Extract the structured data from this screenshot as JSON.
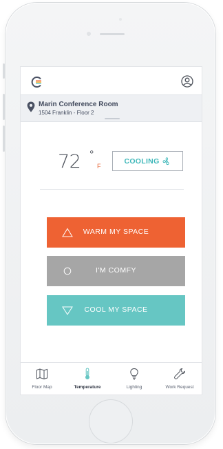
{
  "app": {
    "colors": {
      "warm": "#ee6233",
      "comfy": "#a6a6a6",
      "cool": "#66c6c3",
      "accent_teal": "#3fb8ba",
      "pin": "#4a5163"
    }
  },
  "header": {
    "logo_icon": "brand-logo-icon",
    "profile_icon": "user-circle-icon"
  },
  "location": {
    "icon": "map-pin-icon",
    "room": "Marin Conference Room",
    "address": "1504 Franklin - Floor 2"
  },
  "climate": {
    "temperature": "72",
    "degree_symbol": "°",
    "unit": "F",
    "mode_label": "COOLING",
    "mode_icon": "fan-icon"
  },
  "actions": [
    {
      "label": "WARM MY SPACE",
      "icon": "triangle-up-icon"
    },
    {
      "label": "I'M COMFY",
      "icon": "circle-icon"
    },
    {
      "label": "COOL MY SPACE",
      "icon": "triangle-down-icon"
    }
  ],
  "tabs": [
    {
      "label": "Floor Map",
      "icon": "map-icon",
      "active": false
    },
    {
      "label": "Temperature",
      "icon": "thermometer-icon",
      "active": true
    },
    {
      "label": "Lighting",
      "icon": "lightbulb-icon",
      "active": false
    },
    {
      "label": "Work Request",
      "icon": "wrench-icon",
      "active": false
    }
  ]
}
